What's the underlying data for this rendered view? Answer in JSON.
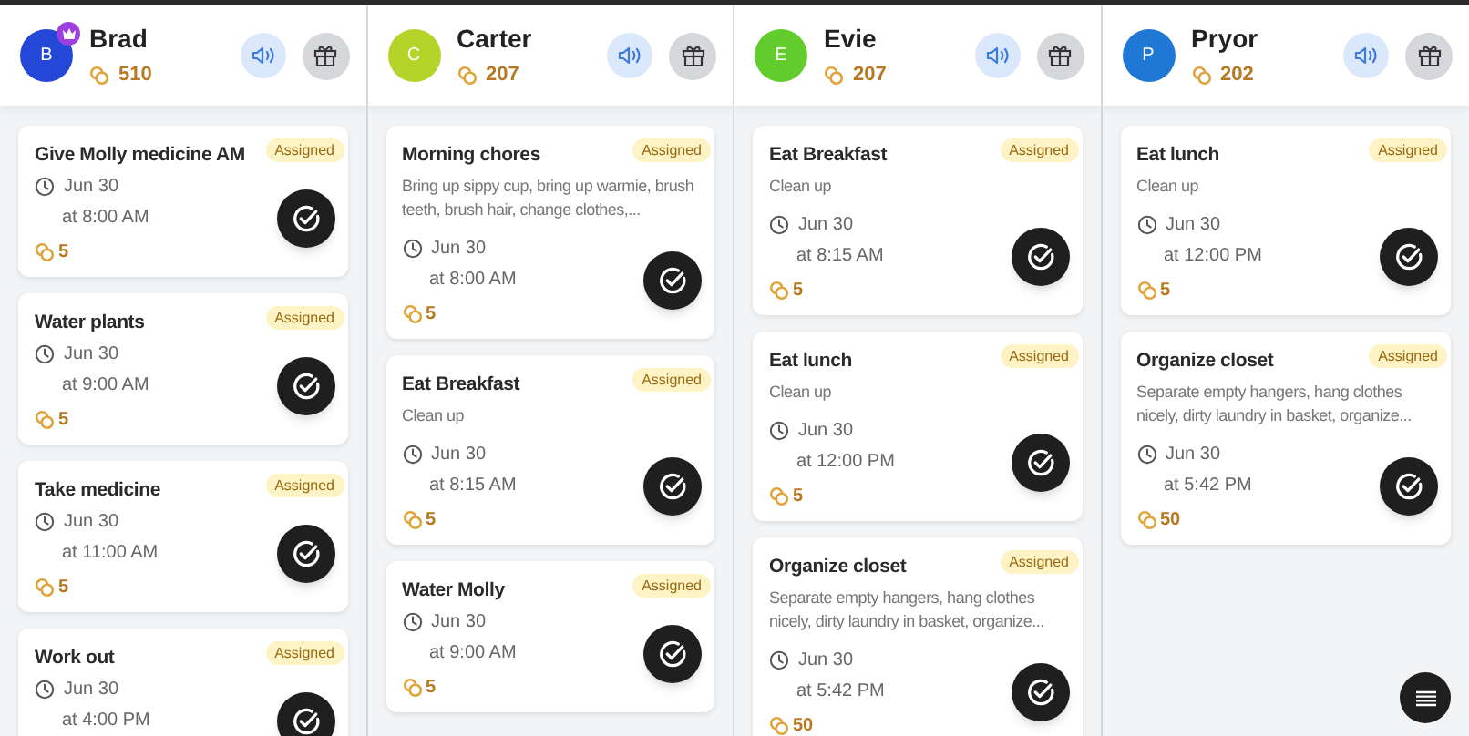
{
  "columns": [
    {
      "name": "Brad",
      "initial": "B",
      "color": "#2447d8",
      "crown": true,
      "points": "510",
      "tasks": [
        {
          "title": "Give Molly medicine AM",
          "status": "Assigned",
          "date": "Jun 30",
          "time": "at 8:00 AM",
          "points": "5"
        },
        {
          "title": "Water plants",
          "status": "Assigned",
          "date": "Jun 30",
          "time": "at 9:00 AM",
          "points": "5"
        },
        {
          "title": "Take medicine",
          "status": "Assigned",
          "date": "Jun 30",
          "time": "at 11:00 AM",
          "points": "5"
        },
        {
          "title": "Work out",
          "status": "Assigned",
          "date": "Jun 30",
          "time": "at 4:00 PM"
        }
      ]
    },
    {
      "name": "Carter",
      "initial": "C",
      "color": "#b4d42a",
      "crown": false,
      "points": "207",
      "tasks": [
        {
          "title": "Morning chores",
          "status": "Assigned",
          "description": "Bring up sippy cup, bring up warmie, brush teeth, brush hair, change clothes,...",
          "date": "Jun 30",
          "time": "at 8:00 AM",
          "points": "5"
        },
        {
          "title": "Eat Breakfast",
          "status": "Assigned",
          "description": "Clean up",
          "date": "Jun 30",
          "time": "at 8:15 AM",
          "points": "5"
        },
        {
          "title": "Water Molly",
          "status": "Assigned",
          "date": "Jun 30",
          "time": "at 9:00 AM",
          "points": "5"
        }
      ]
    },
    {
      "name": "Evie",
      "initial": "E",
      "color": "#62cc2c",
      "crown": false,
      "points": "207",
      "tasks": [
        {
          "title": "Eat Breakfast",
          "status": "Assigned",
          "description": "Clean up",
          "date": "Jun 30",
          "time": "at 8:15 AM",
          "points": "5"
        },
        {
          "title": "Eat lunch",
          "status": "Assigned",
          "description": "Clean up",
          "date": "Jun 30",
          "time": "at 12:00 PM",
          "points": "5"
        },
        {
          "title": "Organize closet",
          "status": "Assigned",
          "description": "Separate empty hangers, hang clothes nicely, dirty laundry in basket, organize...",
          "date": "Jun 30",
          "time": "at 5:42 PM",
          "points": "50"
        }
      ]
    },
    {
      "name": "Pryor",
      "initial": "P",
      "color": "#1f78d6",
      "crown": false,
      "points": "202",
      "tasks": [
        {
          "title": "Eat lunch",
          "status": "Assigned",
          "description": "Clean up",
          "date": "Jun 30",
          "time": "at 12:00 PM",
          "points": "5"
        },
        {
          "title": "Organize closet",
          "status": "Assigned",
          "description": "Separate empty hangers, hang clothes nicely, dirty laundry in basket, organize...",
          "date": "Jun 30",
          "time": "at 5:42 PM",
          "points": "50"
        }
      ]
    }
  ]
}
